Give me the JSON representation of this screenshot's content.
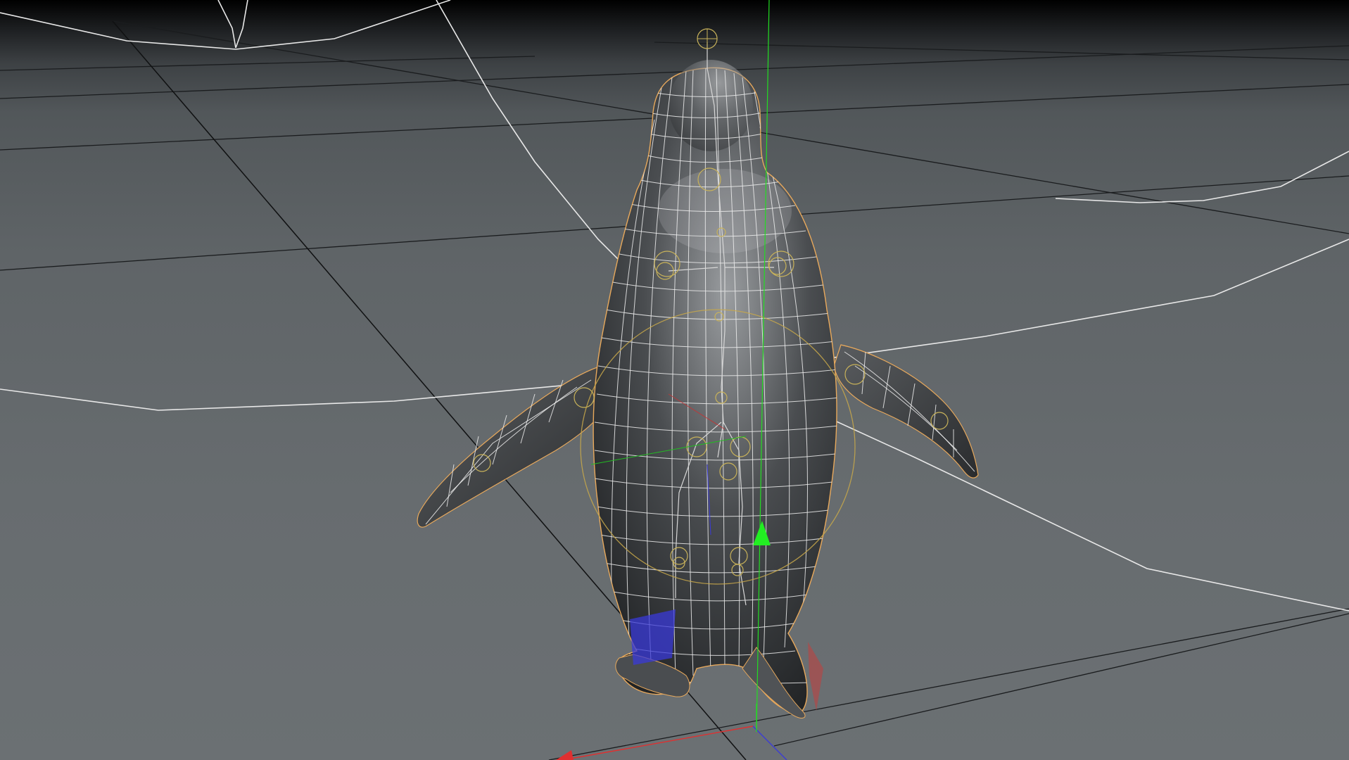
{
  "viewport": {
    "view": "perspective-3d",
    "background_top": "#000000",
    "background_bottom": "#6b7073",
    "grid_color": "#1a1c1e",
    "spline_color": "#e8e8e8",
    "selection_outline_color": "#e8a95c",
    "joint_color": "#c8b25a"
  },
  "scene": {
    "model": "penguin-mesh",
    "display_mode": "shaded-wireframe",
    "rig": "skeleton-joints"
  },
  "axes": {
    "x_color": "#e03030",
    "y_color": "#22dd22",
    "z_color": "#3a3ad8"
  },
  "icons": {
    "top_locator": "target-icon",
    "move_gizmo": "move-gizmo-icon",
    "world_axis": "world-axis-icon"
  }
}
